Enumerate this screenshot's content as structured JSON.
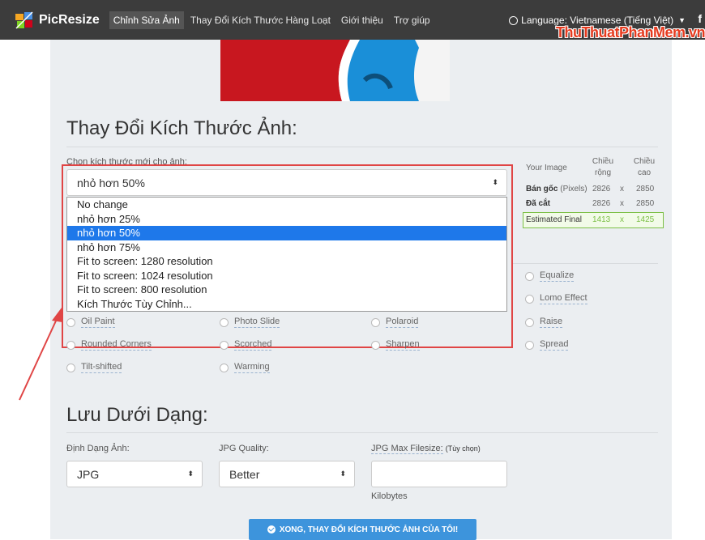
{
  "nav": {
    "brand": "PicResize",
    "items": [
      "Chỉnh Sửa Ảnh",
      "Thay Đổi Kích Thước Hàng Loạt",
      "Giới thiệu",
      "Trợ giúp"
    ],
    "language": "Language: Vietnamese (Tiếng Việt)",
    "facebook": "f"
  },
  "watermark": "ThuThuatPhanMem.vn",
  "resize": {
    "heading": "Thay Đổi Kích Thước Ảnh:",
    "choose_label": "Chọn kích thước mới cho ảnh:",
    "selected": "nhỏ hơn 50%",
    "options": [
      "No change",
      "nhỏ hơn 25%",
      "nhỏ hơn 50%",
      "nhỏ hơn 75%",
      "Fit to screen: 1280 resolution",
      "Fit to screen: 1024 resolution",
      "Fit to screen: 800 resolution",
      "Kích Thước Tùy Chỉnh..."
    ],
    "selected_index": 2
  },
  "info": {
    "your_image": "Your Image",
    "col_width": "Chiều rộng",
    "col_height": "Chiều cao",
    "rows": [
      {
        "label": "Bán gốc",
        "sub": "(Pixels)",
        "w": "2826",
        "x": "x",
        "h": "2850"
      },
      {
        "label": "Đã cắt",
        "sub": "",
        "w": "2826",
        "x": "x",
        "h": "2850"
      },
      {
        "label": "Estimated Final",
        "sub": "",
        "w": "1413",
        "x": "x",
        "h": "1425"
      }
    ]
  },
  "effects": {
    "right_col": [
      "Equalize",
      "Lomo Effect"
    ],
    "rows": [
      [
        "Oil Paint",
        "Photo Slide",
        "Polaroid",
        "Raise"
      ],
      [
        "Rounded Corners",
        "Scorched",
        "Sharpen",
        "Spread"
      ],
      [
        "Tilt-shifted",
        "Warming"
      ]
    ]
  },
  "save": {
    "heading": "Lưu Dưới Dạng:",
    "format_label": "Định Dạng Ảnh:",
    "format_value": "JPG",
    "quality_label": "JPG Quality:",
    "quality_value": "Better",
    "maxsize_label": "JPG Max Filesize:",
    "maxsize_optional": "(Tùy chọn)",
    "maxsize_unit": "Kilobytes",
    "submit": "XONG, THAY ĐỔI KÍCH THƯỚC ẢNH CỦA TÔI!"
  },
  "colors": {
    "navbar": "#3c3c3c",
    "panel": "#ebeef1",
    "highlight": "#1e78ea",
    "annotation": "#e04545",
    "button": "#3d94dc"
  }
}
